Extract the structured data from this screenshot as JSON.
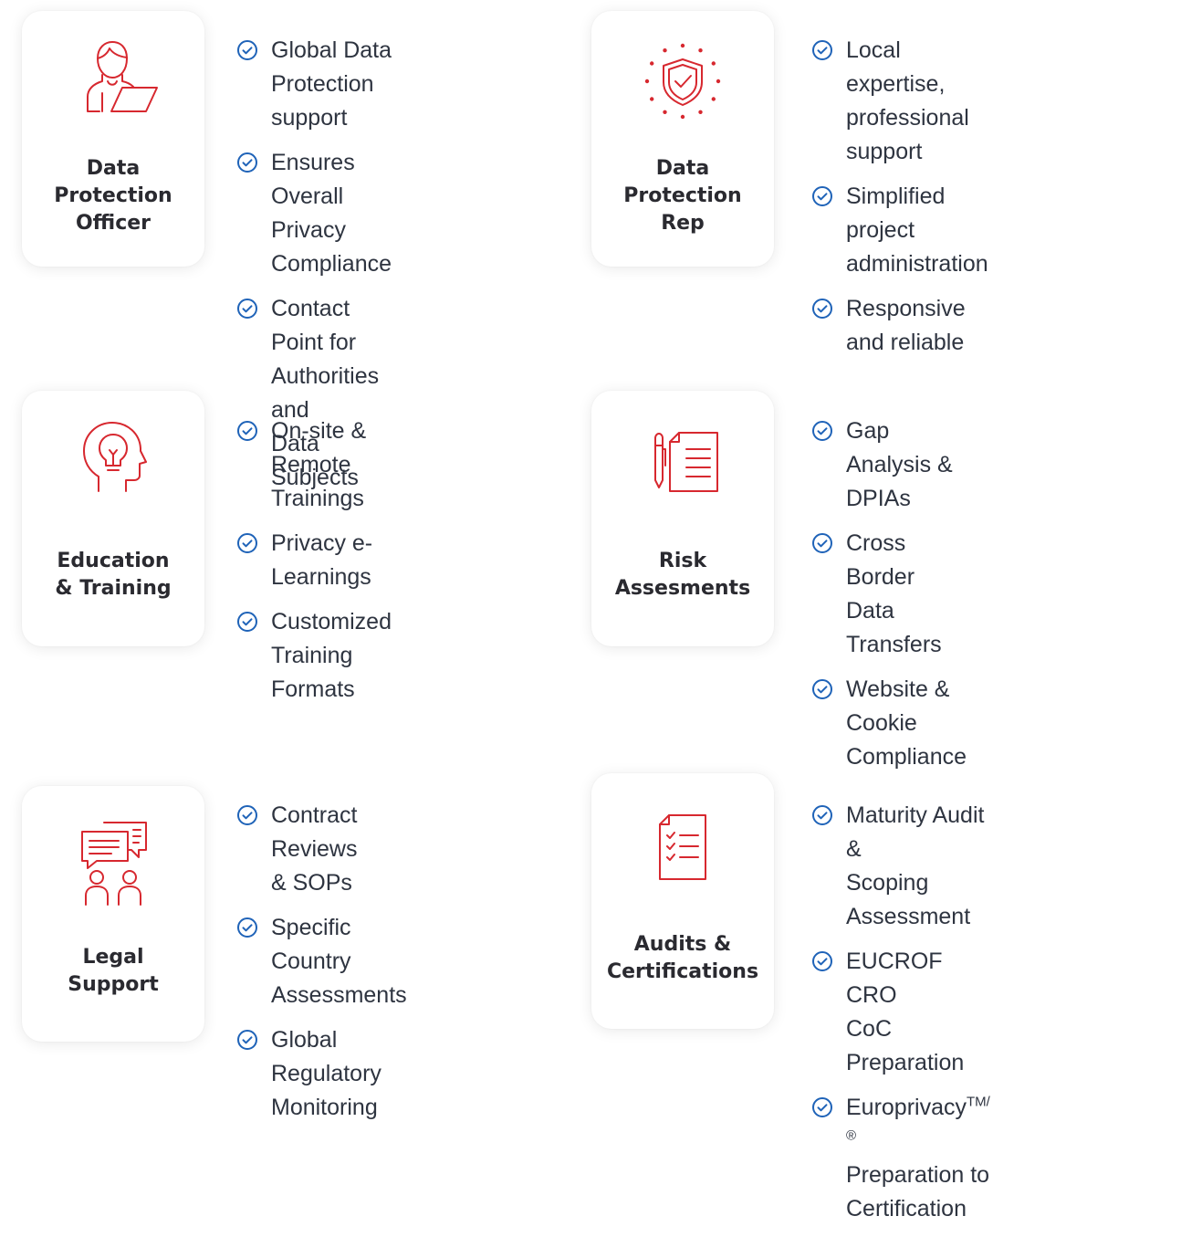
{
  "colors": {
    "accent_red": "#d7282f",
    "check_blue": "#1f63b8"
  },
  "services": [
    {
      "icon": "person-laptop-icon",
      "title": "Data\nProtection\nOfficer",
      "items": [
        "Global Data\nProtection support",
        "Ensures Overall\nPrivacy Compliance",
        "Contact Point for\nAuthorities and\nData Subjects"
      ]
    },
    {
      "icon": "shield-stars-icon",
      "title": "Data\nProtection\nRep",
      "items": [
        "Local expertise,\nprofessional support",
        "Simplified project\nadministration",
        "Responsive\nand reliable"
      ]
    },
    {
      "icon": "head-lightbulb-icon",
      "title": "Education\n& Training",
      "items": [
        "On-site & Remote\nTrainings",
        "Privacy e-Learnings",
        "Customized\nTraining Formats"
      ]
    },
    {
      "icon": "pen-document-icon",
      "title": "Risk\nAssesments",
      "items": [
        "Gap Analysis & DPIAs",
        "Cross Border\nData Transfers",
        "Website & Cookie\nCompliance"
      ]
    },
    {
      "icon": "people-chat-icon",
      "title": "Legal\nSupport",
      "items": [
        "Contract Reviews\n& SOPs",
        "Specific Country\nAssessments",
        "Global Regulatory\nMonitoring"
      ]
    },
    {
      "icon": "checklist-document-icon",
      "title": "Audits &\nCertifications",
      "items": [
        "Maturity Audit &\nScoping Assessment",
        "EUCROF CRO\nCoC Preparation",
        "Europrivacy"
      ],
      "trademark": "TM/®",
      "last_item_suffix": "Preparation to Certification"
    }
  ]
}
